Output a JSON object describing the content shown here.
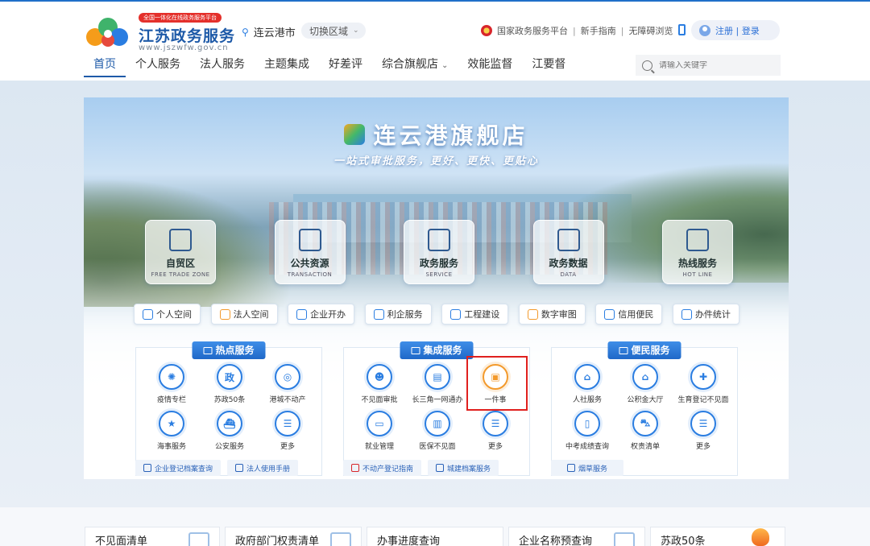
{
  "header": {
    "logo_badge": "全国一体化在线政务服务平台",
    "logo_title": "江苏政务服务",
    "logo_url": "www.jszwfw.gov.cn",
    "city": "连云港市",
    "area_switch": "切换区域",
    "top_links": [
      "国家政务服务平台",
      "新手指南",
      "无障碍浏览"
    ],
    "login": "注册 | 登录"
  },
  "nav": {
    "items": [
      "首页",
      "个人服务",
      "法人服务",
      "主题集成",
      "好差评",
      "综合旗舰店",
      "效能监督",
      "江要督"
    ],
    "search_placeholder": "请输入关键字"
  },
  "banner": {
    "title": "连云港旗舰店",
    "subtitle": "一站式审批服务，更好、更快、更贴心",
    "tiles": [
      {
        "name": "自贸区",
        "en": "FREE TRADE ZONE"
      },
      {
        "name": "公共资源",
        "en": "TRANSACTION"
      },
      {
        "name": "政务服务",
        "en": "SERVICE"
      },
      {
        "name": "政务数据",
        "en": "DATA"
      },
      {
        "name": "热线服务",
        "en": "HOT LINE"
      }
    ],
    "shortcuts": [
      "个人空间",
      "法人空间",
      "企业开办",
      "利企服务",
      "工程建设",
      "数字审图",
      "信用便民",
      "办件统计"
    ]
  },
  "panels": [
    {
      "title": "热点服务",
      "items": [
        "疫情专栏",
        "苏政50条",
        "港城不动产",
        "海事服务",
        "公安服务",
        "更多"
      ],
      "links": [
        "企业登记档案查询",
        "法人使用手册"
      ]
    },
    {
      "title": "集成服务",
      "items": [
        "不见面审批",
        "长三角一网通办",
        "一件事",
        "就业管理",
        "医保不见面",
        "更多"
      ],
      "links": [
        "不动产登记指南",
        "城建档案服务"
      ]
    },
    {
      "title": "便民服务",
      "items": [
        "人社服务",
        "公积金大厅",
        "生育登记不见面",
        "中考成绩查询",
        "权责清单",
        "更多"
      ],
      "links": [
        "烟草服务"
      ]
    }
  ],
  "strip": [
    "不见面清单",
    "政府部门权责清单",
    "办事进度查询",
    "企业名称预查询",
    "苏政50条"
  ],
  "colors": {
    "brand": "#1e5aa8",
    "accent": "#2a7de1",
    "highlight": "#e0201e",
    "orange": "#f39a2c"
  }
}
